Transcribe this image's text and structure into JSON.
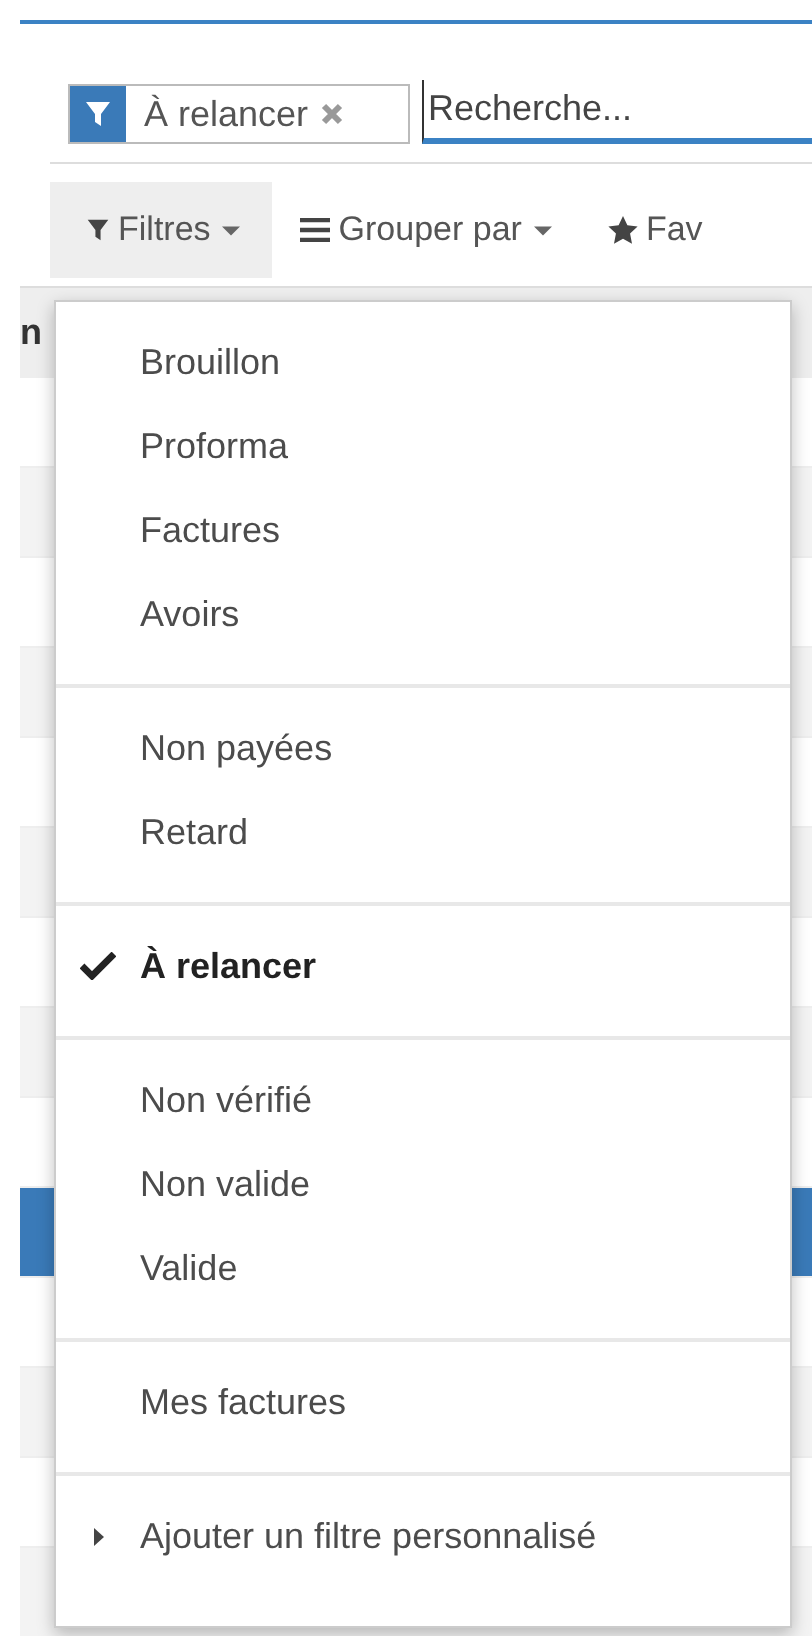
{
  "search": {
    "facet": {
      "label": "À relancer"
    },
    "placeholder": "Recherche..."
  },
  "toolbar": [
    {
      "kind": "filter",
      "label": "Filtres",
      "open": true
    },
    {
      "kind": "group",
      "label": "Grouper par",
      "open": false
    },
    {
      "kind": "favorite",
      "label": "Fav",
      "open": false
    }
  ],
  "list": {
    "header": "n",
    "rows": [
      {
        "selected": false
      },
      {
        "selected": false
      },
      {
        "selected": false
      },
      {
        "selected": false
      },
      {
        "selected": false
      },
      {
        "selected": false
      },
      {
        "selected": false
      },
      {
        "selected": false
      },
      {
        "selected": false
      },
      {
        "selected": true
      },
      {
        "selected": false
      },
      {
        "selected": false
      },
      {
        "selected": false
      },
      {
        "selected": false
      }
    ]
  },
  "filter_menu": {
    "groups": [
      {
        "items": [
          {
            "kind": "option",
            "label": "Brouillon",
            "checked": false
          },
          {
            "kind": "option",
            "label": "Proforma",
            "checked": false
          },
          {
            "kind": "option",
            "label": "Factures",
            "checked": false
          },
          {
            "kind": "option",
            "label": "Avoirs",
            "checked": false
          }
        ]
      },
      {
        "items": [
          {
            "kind": "option",
            "label": "Non payées",
            "checked": false
          },
          {
            "kind": "option",
            "label": "Retard",
            "checked": false
          }
        ]
      },
      {
        "items": [
          {
            "kind": "option",
            "label": "À relancer",
            "checked": true
          }
        ]
      },
      {
        "items": [
          {
            "kind": "option",
            "label": "Non vérifié",
            "checked": false
          },
          {
            "kind": "option",
            "label": "Non valide",
            "checked": false
          },
          {
            "kind": "option",
            "label": "Valide",
            "checked": false
          }
        ]
      },
      {
        "items": [
          {
            "kind": "option",
            "label": "Mes factures",
            "checked": false
          }
        ]
      },
      {
        "items": [
          {
            "kind": "expander",
            "label": "Ajouter un filtre personnalisé",
            "checked": false
          }
        ]
      }
    ]
  }
}
